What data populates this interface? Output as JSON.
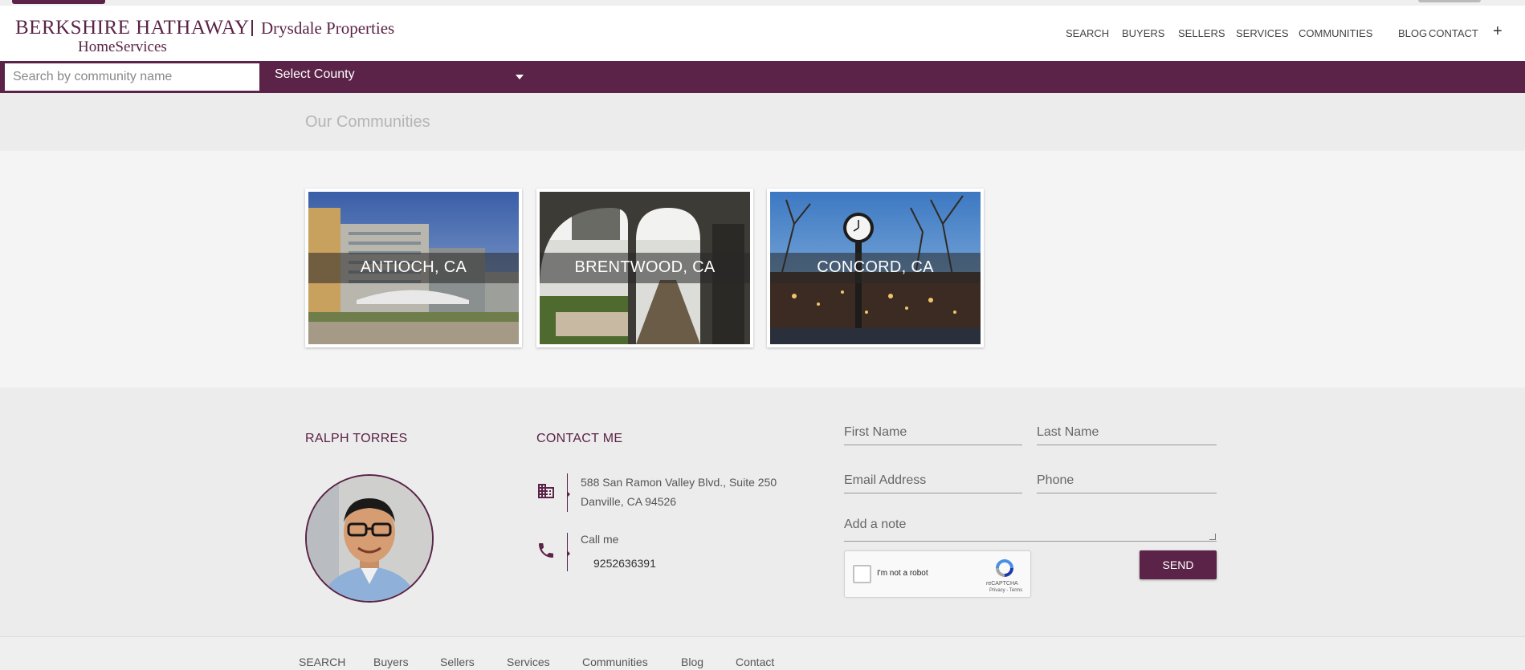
{
  "logo": {
    "line1": "BERKSHIRE HATHAWAY",
    "line2": "HomeServices",
    "brokerage": "Drysdale Properties"
  },
  "nav": {
    "items": [
      "SEARCH",
      "BUYERS",
      "SELLERS",
      "SERVICES",
      "COMMUNITIES",
      "BLOG",
      "CONTACT"
    ],
    "more": "+"
  },
  "search": {
    "placeholder": "Search by community name",
    "county_label": "Select County"
  },
  "communities": {
    "title": "Our Communities",
    "cards": [
      {
        "label": "ANTIOCH, CA"
      },
      {
        "label": "BRENTWOOD, CA"
      },
      {
        "label": "CONCORD, CA"
      }
    ]
  },
  "agent": {
    "name": "RALPH TORRES"
  },
  "contact": {
    "title": "CONTACT ME",
    "address_line1": "588 San Ramon Valley Blvd., Suite 250",
    "address_line2": "Danville, CA 94526",
    "call_label": "Call me",
    "phone": "9252636391"
  },
  "form": {
    "first_name": "First Name",
    "last_name": "Last Name",
    "email": "Email Address",
    "phone": "Phone",
    "note": "Add a note",
    "captcha_text": "I'm not a robot",
    "captcha_brand": "reCAPTCHA",
    "captcha_terms": "Privacy - Terms",
    "send": "SEND"
  },
  "footer_nav": [
    "SEARCH",
    "Buyers",
    "Sellers",
    "Services",
    "Communities",
    "Blog",
    "Contact"
  ],
  "colors": {
    "brand": "#5a2347",
    "header_bg": "#ffffff",
    "band_bg": "#ececec"
  }
}
